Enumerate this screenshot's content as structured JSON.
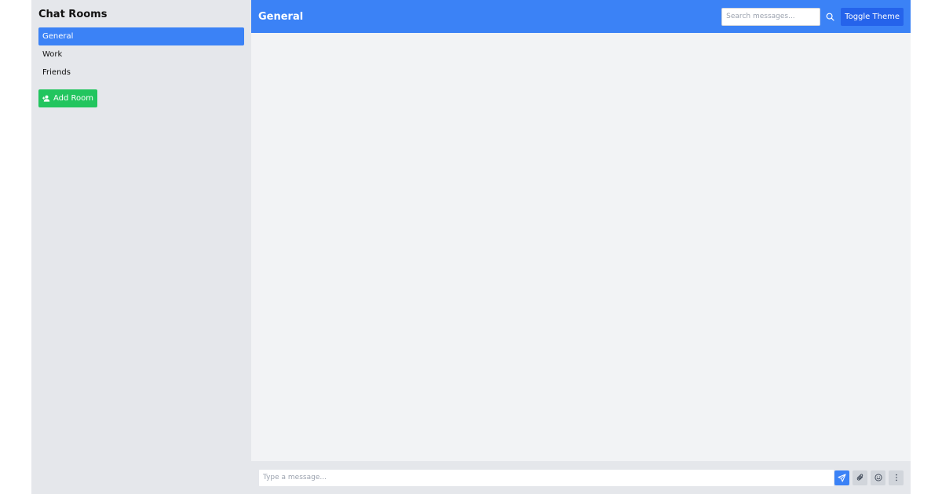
{
  "sidebar": {
    "title": "Chat Rooms",
    "rooms": [
      {
        "label": "General",
        "active": true
      },
      {
        "label": "Work",
        "active": false
      },
      {
        "label": "Friends",
        "active": false
      }
    ],
    "add_room": {
      "label": "Add Room",
      "icon": "user-plus-icon"
    }
  },
  "header": {
    "title": "General",
    "search": {
      "placeholder": "Search messages...",
      "value": "",
      "icon": "search-icon"
    },
    "toggle_theme_label": "Toggle Theme"
  },
  "composer": {
    "placeholder": "Type a message...",
    "value": "",
    "send_icon": "send-icon",
    "attach_icon": "paperclip-icon",
    "emoji_icon": "emoji-icon",
    "more_icon": "more-vertical-icon"
  },
  "colors": {
    "accent": "#3b82f6",
    "accent_dark": "#2563eb",
    "success": "#22c55e",
    "sidebar_bg": "#e5e7eb",
    "messages_bg": "#f2f3f5"
  }
}
